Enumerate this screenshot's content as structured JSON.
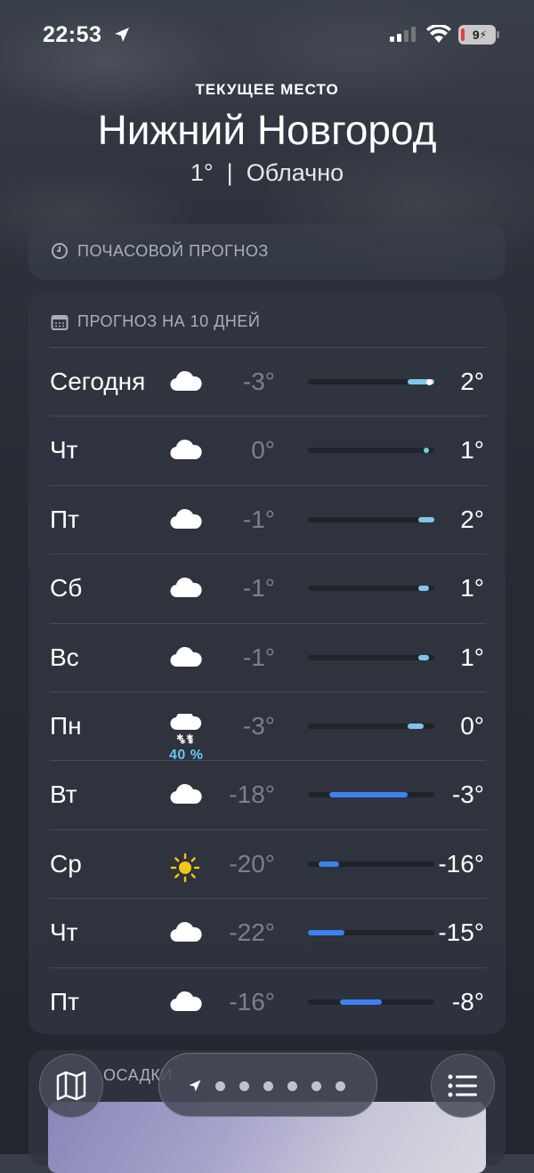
{
  "status": {
    "time": "22:53",
    "battery": "9"
  },
  "header": {
    "subtitle": "ТЕКУЩЕЕ МЕСТО",
    "city": "Нижний Новгород",
    "conditions": "1°  |  Облачно"
  },
  "hourly": {
    "label": "ПОЧАСОВОЙ ПРОГНОЗ",
    "icon": "clock-icon"
  },
  "daily": {
    "label": "ПРОГНОЗ НА 10 ДНЕЙ",
    "icon": "calendar-icon",
    "days": [
      {
        "day": "Сегодня",
        "icon": "cloud-icon",
        "low": "-3°",
        "high": "2°",
        "current": true
      },
      {
        "day": "Чт",
        "icon": "cloud-icon",
        "low": "0°",
        "high": "1°"
      },
      {
        "day": "Пт",
        "icon": "cloud-icon",
        "low": "-1°",
        "high": "2°"
      },
      {
        "day": "Сб",
        "icon": "cloud-icon",
        "low": "-1°",
        "high": "1°"
      },
      {
        "day": "Вс",
        "icon": "cloud-icon",
        "low": "-1°",
        "high": "1°"
      },
      {
        "day": "Пн",
        "icon": "snow-cloud-icon",
        "precip": "40 %",
        "low": "-3°",
        "high": "0°"
      },
      {
        "day": "Вт",
        "icon": "cloud-icon",
        "low": "-18°",
        "high": "-3°"
      },
      {
        "day": "Ср",
        "icon": "sun-icon",
        "low": "-20°",
        "high": "-16°"
      },
      {
        "day": "Чт",
        "icon": "cloud-icon",
        "low": "-22°",
        "high": "-15°"
      },
      {
        "day": "Пт",
        "icon": "cloud-icon",
        "low": "-16°",
        "high": "-8°"
      }
    ]
  },
  "precip": {
    "label": "ОСАДКИ"
  },
  "colors": {
    "warm": "#7fc6e8",
    "cold": "#3b82f0",
    "accent_text": "#63c6f2"
  }
}
